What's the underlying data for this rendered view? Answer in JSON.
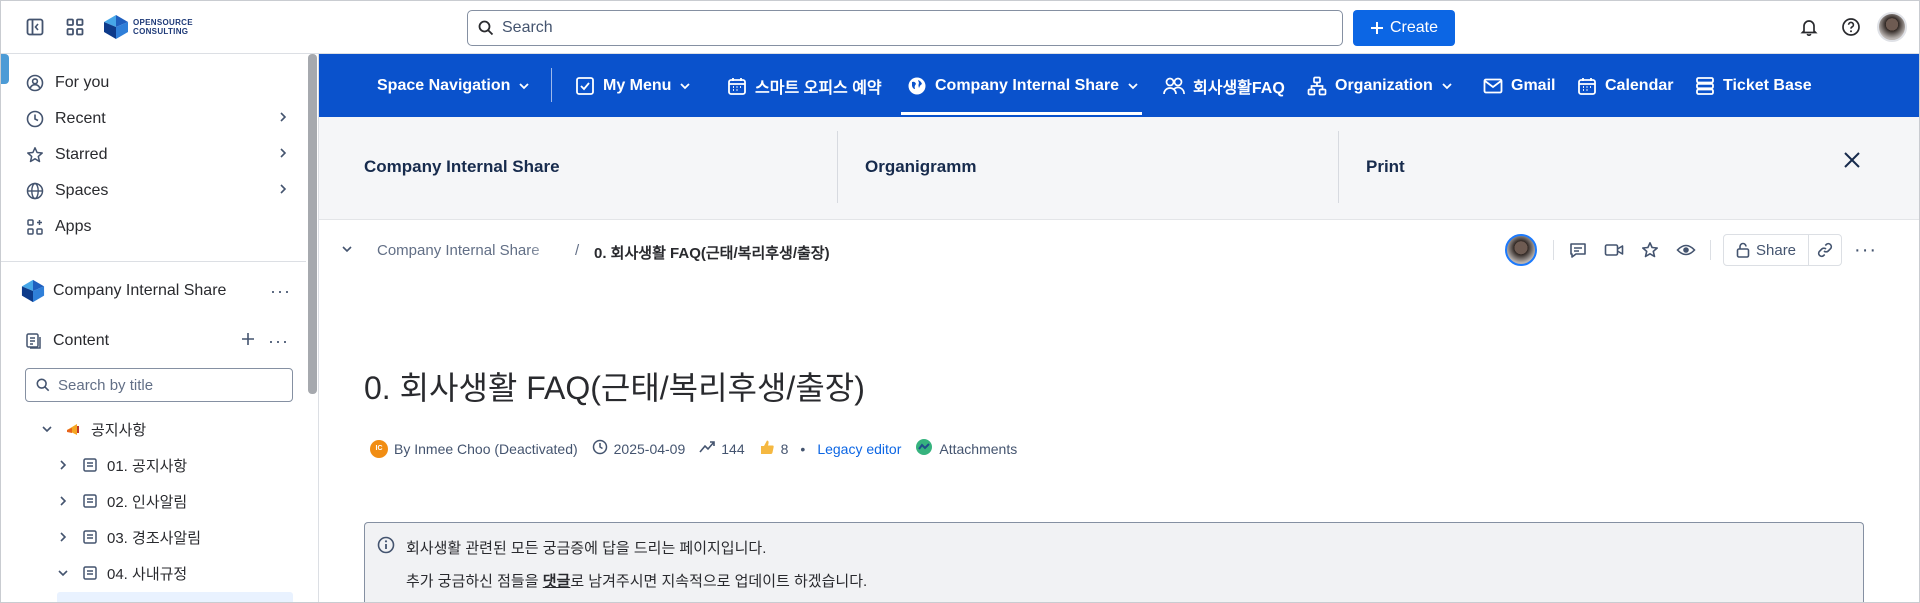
{
  "topbar": {
    "logo_line1": "OPENSOURCE",
    "logo_line2": "CONSULTING",
    "search_placeholder": "Search",
    "create_label": "Create",
    "icons": [
      "sidebar-toggle-icon",
      "app-switcher-icon",
      "bell-icon",
      "help-icon"
    ]
  },
  "sidebar": {
    "nav": [
      {
        "label": "For you",
        "icon": "user-circle-icon"
      },
      {
        "label": "Recent",
        "icon": "clock-icon"
      },
      {
        "label": "Starred",
        "icon": "star-icon"
      },
      {
        "label": "Spaces",
        "icon": "globe-icon"
      },
      {
        "label": "Apps",
        "icon": "apps-icon"
      }
    ],
    "space_name": "Company Internal Share",
    "content_label": "Content",
    "search_placeholder": "Search by title",
    "tree": [
      {
        "label": "공지사항",
        "expanded": true
      },
      {
        "label": "01. 공지사항"
      },
      {
        "label": "02. 인사알림"
      },
      {
        "label": "03. 경조사알림"
      },
      {
        "label": "04. 사내규정",
        "expanded": true
      }
    ]
  },
  "bluenav": {
    "items": [
      {
        "label": "Space Navigation",
        "icon": "",
        "dropdown": true
      },
      {
        "label": "My Menu",
        "icon": "checkbox-icon",
        "dropdown": true
      },
      {
        "label": "스마트 오피스 예약",
        "icon": "calendar-icon",
        "dropdown": false
      },
      {
        "label": "Company Internal Share",
        "icon": "globe-icon",
        "dropdown": true,
        "active": true
      },
      {
        "label": "회사생활FAQ",
        "icon": "people-icon",
        "dropdown": false
      },
      {
        "label": "Organization",
        "icon": "org-chart-icon",
        "dropdown": true
      },
      {
        "label": "Gmail",
        "icon": "mail-icon",
        "dropdown": false
      },
      {
        "label": "Calendar",
        "icon": "calendar-icon",
        "dropdown": false
      },
      {
        "label": "Ticket Base",
        "icon": "database-icon",
        "dropdown": false
      }
    ]
  },
  "subtabs": {
    "tab1": "Company Internal Share",
    "tab2": "Organigramm",
    "tab3": "Print"
  },
  "breadcrumb": {
    "parent": "Company Internal Share",
    "separator": "/",
    "current": "0. 회사생활 FAQ(근태/복리후생/출장)"
  },
  "page_tools": {
    "share_label": "Share"
  },
  "page": {
    "title": "0. 회사생활 FAQ(근태/복리후생/출장)",
    "author_initials": "IC",
    "author": "By Inmee Choo (Deactivated)",
    "date": "2025-04-09",
    "views": "144",
    "likes": "8",
    "editor": "Legacy editor",
    "attachments": "Attachments",
    "info_line1": "회사생활 관련된 모든 궁금증에 답을 드리는 페이지입니다.",
    "info_line2_pre": "추가 궁금하신 점들을 ",
    "info_line2_bold": "댓글",
    "info_line2_post": "로 남겨주시면 지속적으로 업데이트 하겠습니다."
  },
  "colors": {
    "brand_blue": "#0a52cc",
    "create_blue": "#0c66e4",
    "author_badge": "#f18d13"
  }
}
